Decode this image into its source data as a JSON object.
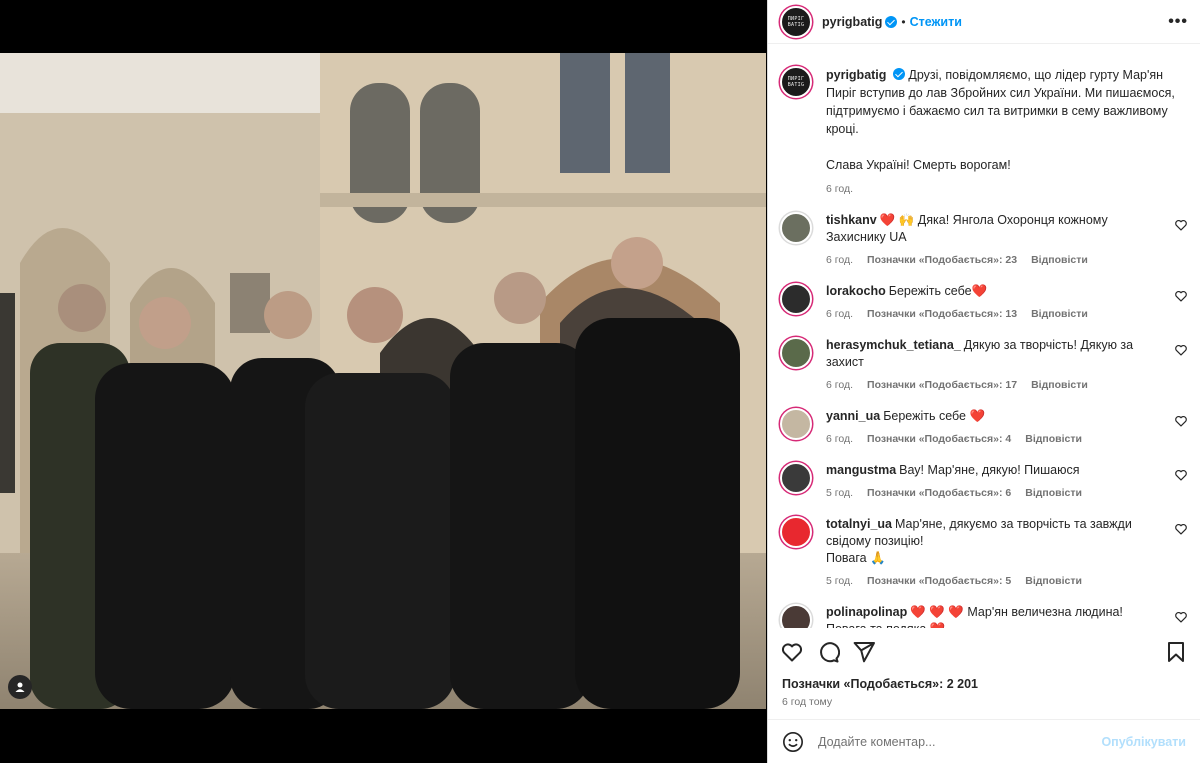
{
  "post": {
    "username": "pyrigbatig",
    "follow_label": "Стежити",
    "more_label": "•••",
    "logo_text": "ПИРІГ\nBATIG"
  },
  "caption": {
    "username": "pyrigbatig",
    "text": "Друзі, повідомляємо, що лідер гурту Мар'ян Пиріг вступив до лав Збройних сил України. Ми пишаємося, підтримуємо і бажаємо сил та витримки в сему важливому кроці.",
    "text2": "Слава Україні! Смерть ворогам!",
    "time": "6 год."
  },
  "comments": [
    {
      "user": "tishkanv",
      "text": "❤️ 🙌 Дяка! Янгола Охоронця кожному Захиснику UA",
      "time": "6 год.",
      "likes": "Позначки «Подобається»: 23",
      "reply": "Відповісти",
      "avatar_color": "#6b6f60"
    },
    {
      "user": "lorakocho",
      "text": "Бережіть себе❤️",
      "time": "6 год.",
      "likes": "Позначки «Подобається»: 13",
      "reply": "Відповісти",
      "avatar_color": "#2c2c2c"
    },
    {
      "user": "herasymchuk_tetiana_",
      "text": "Дякую за творчість! Дякую за захист",
      "time": "6 год.",
      "likes": "Позначки «Подобається»: 17",
      "reply": "Відповісти",
      "avatar_color": "#5a6a4a"
    },
    {
      "user": "yanni_ua",
      "text": "Бережіть себе ❤️",
      "time": "6 год.",
      "likes": "Позначки «Подобається»: 4",
      "reply": "Відповісти",
      "avatar_color": "#c4b7a2"
    },
    {
      "user": "mangustma",
      "text": "Вау! Мар'яне, дякую! Пишаюся",
      "time": "5 год.",
      "likes": "Позначки «Подобається»: 6",
      "reply": "Відповісти",
      "avatar_color": "#3a3a3a"
    },
    {
      "user": "totalnyi_ua",
      "text": "Мар'яне, дякуємо за творчість та завжди свідому позицію!\nПовага 🙏",
      "time": "5 год.",
      "likes": "Позначки «Подобається»: 5",
      "reply": "Відповісти",
      "avatar_color": "#e8282f"
    },
    {
      "user": "polinapolinap",
      "text": "❤️ ❤️ ❤️ Мар'ян величезна людина! Повага та подяка ❤️",
      "time": "",
      "likes": "",
      "reply": "",
      "avatar_color": "#4a3a36"
    }
  ],
  "footer": {
    "likes": "Позначки «Подобається»: 2 201",
    "time": "6 год тому",
    "placeholder": "Додайте коментар...",
    "post_label": "Опублікувати"
  },
  "colors": {
    "accent": "#0095f6",
    "heart": "#e0245e",
    "muted": "#737373"
  }
}
